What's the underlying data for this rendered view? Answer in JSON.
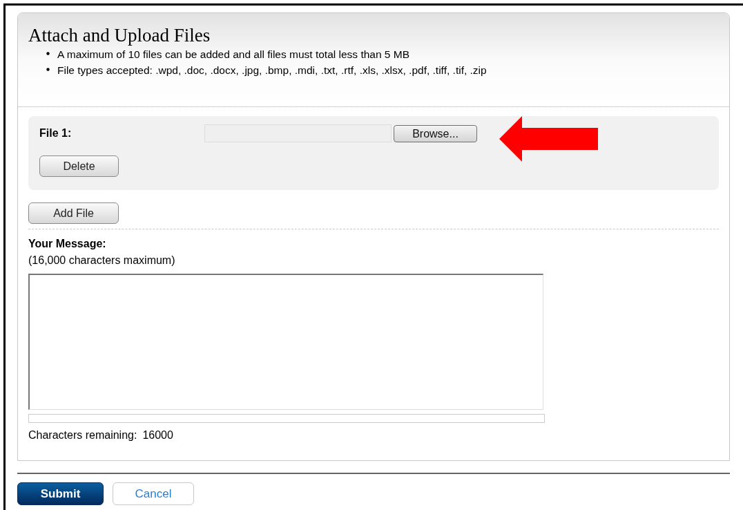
{
  "title": "Attach and Upload Files",
  "notes": [
    "A maximum of 10 files can be added and all files must total less than 5 MB",
    "File types accepted: .wpd, .doc, .docx, .jpg, .bmp, .mdi, .txt, .rtf, .xls, .xlsx, .pdf, .tiff, .tif, .zip"
  ],
  "files": [
    {
      "label": "File 1:",
      "browse": "Browse...",
      "delete": "Delete"
    }
  ],
  "add_file": "Add File",
  "message": {
    "label": "Your Message:",
    "hint": "(16,000 characters maximum)",
    "meter": {
      "level": 0
    },
    "remaining_label": "Characters remaining:",
    "remaining": "16000"
  },
  "buttons": [
    {
      "label": "Submit",
      "kind": "primary"
    },
    {
      "label": "Cancel",
      "kind": "secondary"
    }
  ]
}
